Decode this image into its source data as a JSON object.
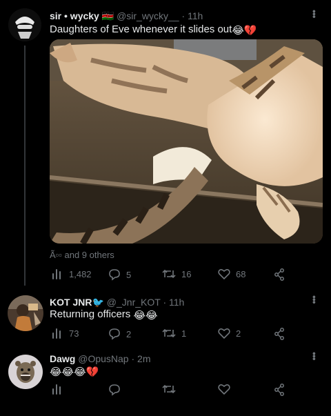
{
  "tweets": [
    {
      "name": "sir • wycky",
      "flag": "🇰🇪",
      "handle": "@sir_wycky__",
      "time": "11h",
      "text": "Daughters of Eve whenever it slides out",
      "emojis": [
        "😂",
        "💔"
      ],
      "liked_by": "Ã▫▫ and 9 others",
      "views": "1,482",
      "replies": "5",
      "retweets": "16",
      "likes": "68"
    },
    {
      "name": "KOT JNR",
      "flag": "🐦",
      "handle": "@_Jnr_KOT",
      "time": "11h",
      "text": "Returning officers",
      "emojis": [
        "😂",
        "😂"
      ],
      "views": "73",
      "replies": "2",
      "retweets": "1",
      "likes": "2"
    },
    {
      "name": "Dawg",
      "handle": "@OpusNap",
      "time": "2m",
      "emojis": [
        "😂",
        "😂",
        "😂",
        "💔"
      ],
      "views": "",
      "replies": "",
      "retweets": "",
      "likes": ""
    }
  ],
  "colors": {
    "text": "#e7e9ea",
    "secondary": "#71767b",
    "background": "#000000"
  }
}
